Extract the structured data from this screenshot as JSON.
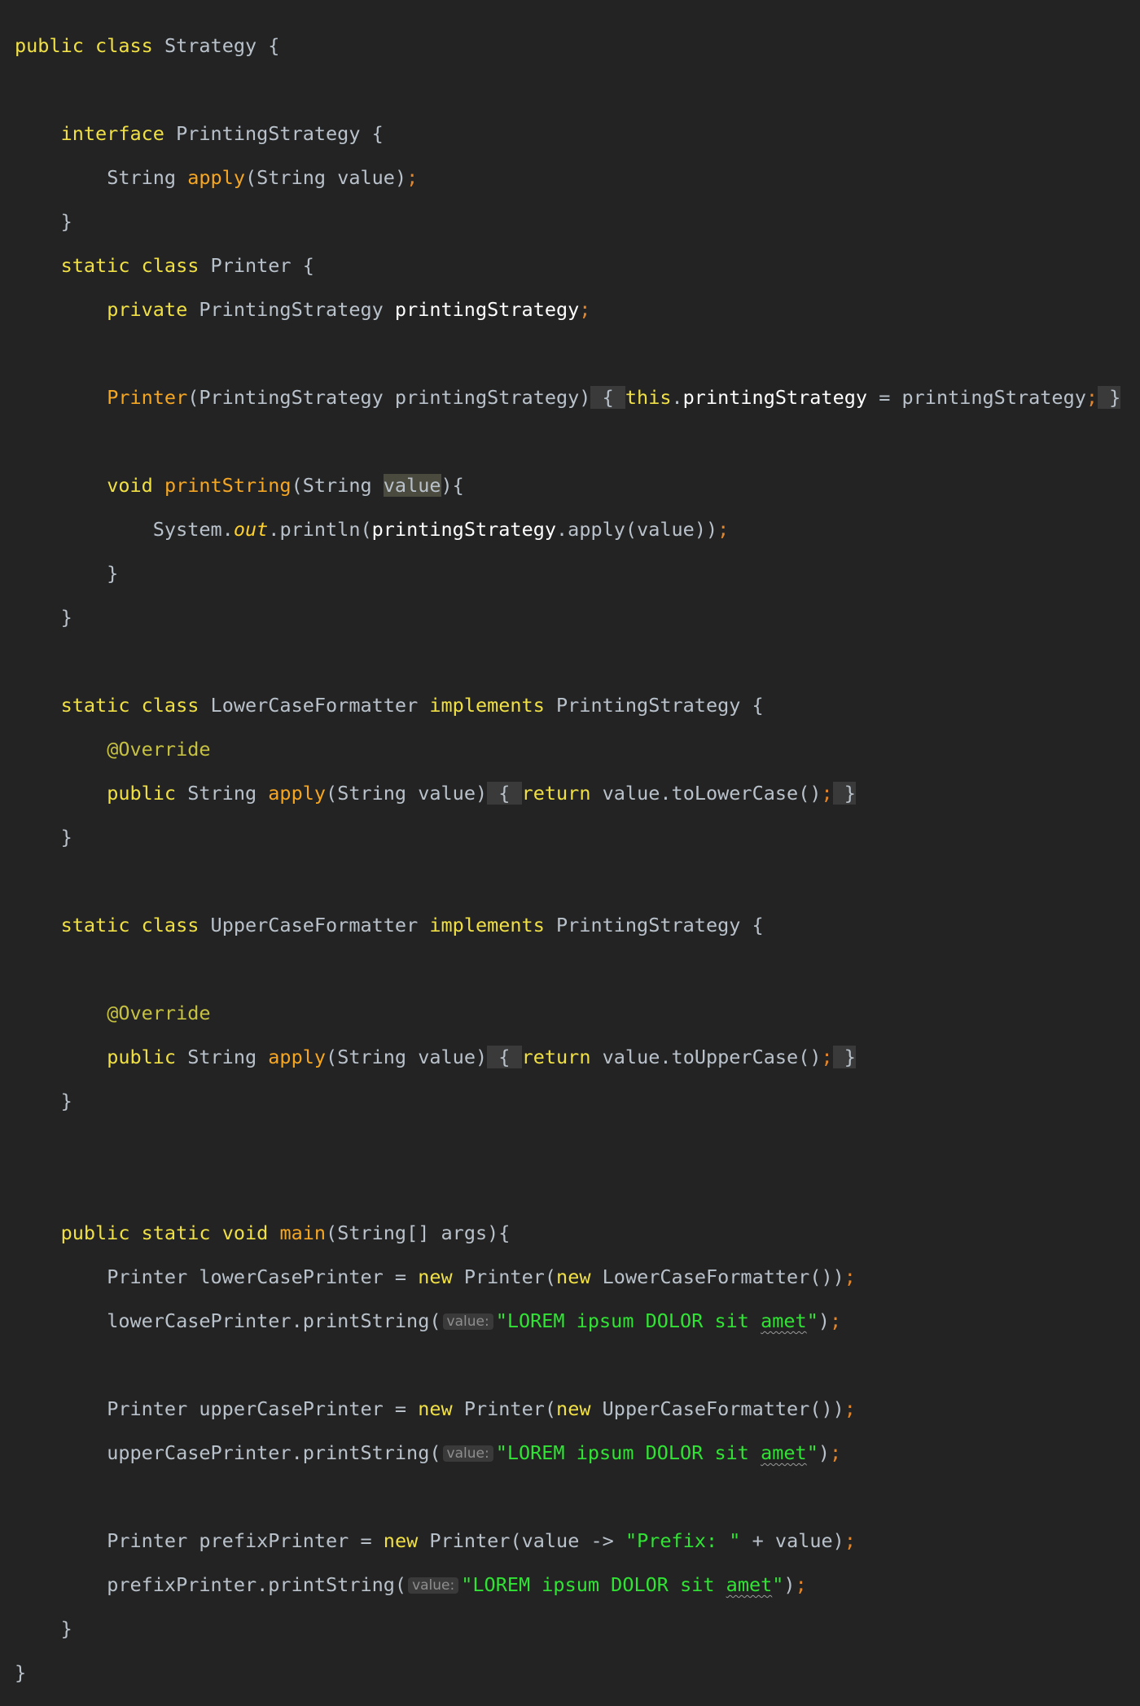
{
  "editor": {
    "background": "#232323",
    "colors": {
      "keyword": "#f0e045",
      "method": "#f5a623",
      "punctuation": "#e3862b",
      "string": "#31e334",
      "text": "#b9c2cb",
      "field": "#ffffff",
      "hint": "#8e8e8e"
    }
  },
  "tokens": {
    "public": "public",
    "class": "class",
    "static": "static",
    "interface": "interface",
    "private": "private",
    "void": "void",
    "this": "this",
    "implements": "implements",
    "return": "return",
    "new": "new",
    "override": "@Override",
    "cls_strategy": "Strategy",
    "cls_printing_strategy": "PrintingStrategy",
    "cls_printer": "Printer",
    "cls_lower_formatter": "LowerCaseFormatter",
    "cls_upper_formatter": "UpperCaseFormatter",
    "type_string": "String",
    "type_string_array": "String[]",
    "m_apply": "apply",
    "m_print_string": "printString",
    "m_main": "main",
    "m_println": "println",
    "m_to_lower": "toLowerCase",
    "m_to_upper": "toUpperCase",
    "f_printing_strategy": "printingStrategy",
    "v_value": "value",
    "v_args": "args",
    "v_lower_printer": "lowerCasePrinter",
    "v_upper_printer": "upperCasePrinter",
    "v_prefix_printer": "prefixPrinter",
    "sys": "System",
    "out": "out",
    "hint_value": "value:",
    "str_lorem_open": "\"LOREM ipsum DOLOR sit ",
    "str_amet": "amet",
    "str_quote": "\"",
    "str_prefix": "\"Prefix: \"",
    "arrow": "->",
    "plus": "+",
    "eq": "="
  }
}
